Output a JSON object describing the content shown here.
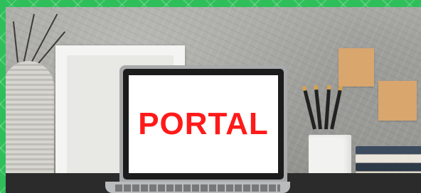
{
  "screen": {
    "text": "PORTAL",
    "text_color": "#ff1a1a",
    "background": "#ffffff"
  },
  "border": {
    "color": "#2fbf5a"
  },
  "icons": {
    "vase": "vase-icon",
    "picture_frame": "picture-frame-icon",
    "laptop": "laptop-icon",
    "pencil_cup": "pencil-cup-icon",
    "sticky_note": "sticky-note-icon",
    "books": "book-stack-icon"
  }
}
